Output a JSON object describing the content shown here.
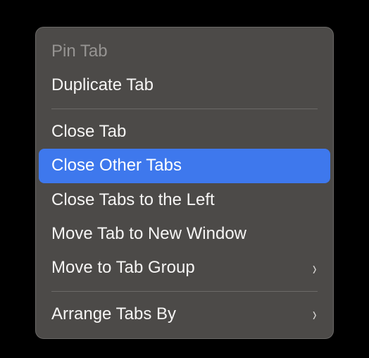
{
  "menu": {
    "pin_tab": "Pin Tab",
    "duplicate_tab": "Duplicate Tab",
    "close_tab": "Close Tab",
    "close_other_tabs": "Close Other Tabs",
    "close_tabs_left": "Close Tabs to the Left",
    "move_to_new_window": "Move Tab to New Window",
    "move_to_tab_group": "Move to Tab Group",
    "arrange_tabs_by": "Arrange Tabs By"
  }
}
